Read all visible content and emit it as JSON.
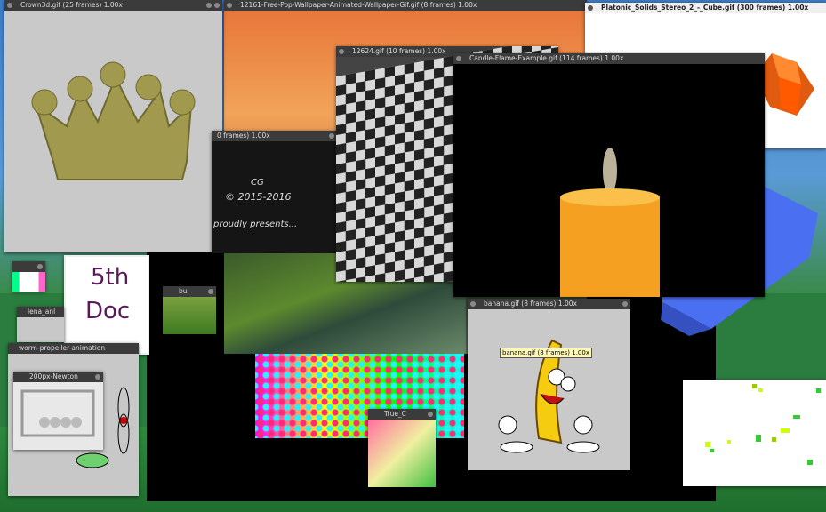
{
  "windows": {
    "crown": {
      "title": "Crown3d.gif (25 frames)  1.00x"
    },
    "wallpaper": {
      "title": "12161-Free-Pop-Wallpaper-Animated-Wallpaper-Gif.gif (8 frames)  1.00x"
    },
    "platonic": {
      "title": "Platonic_Solids_Stereo_2_-_Cube.gif (300 frames)  1.00x"
    },
    "gif12624": {
      "title": "12624.gif (10 frames)  1.00x"
    },
    "candle": {
      "title": "Candle-Flame-Example.gif (114 frames)  1.00x"
    },
    "intro": {
      "title": "0 frames)  1.00x",
      "line1": "CG",
      "line2": "© 2015-2016",
      "line3": "proudly presents..."
    },
    "small_tl": {
      "title": ""
    },
    "lena": {
      "title": "lena_anl"
    },
    "docs": {
      "line1": "5th",
      "line2": "Doc"
    },
    "bu": {
      "title": "bu"
    },
    "worm": {
      "title": "worm-propeller-animation"
    },
    "newton": {
      "title": "200px-Newton"
    },
    "banana": {
      "title": "banana.gif (8 frames)  1.00x",
      "tooltip": "banana.gif (8 frames)  1.00x"
    },
    "truecolor": {
      "title": "True_C"
    }
  }
}
